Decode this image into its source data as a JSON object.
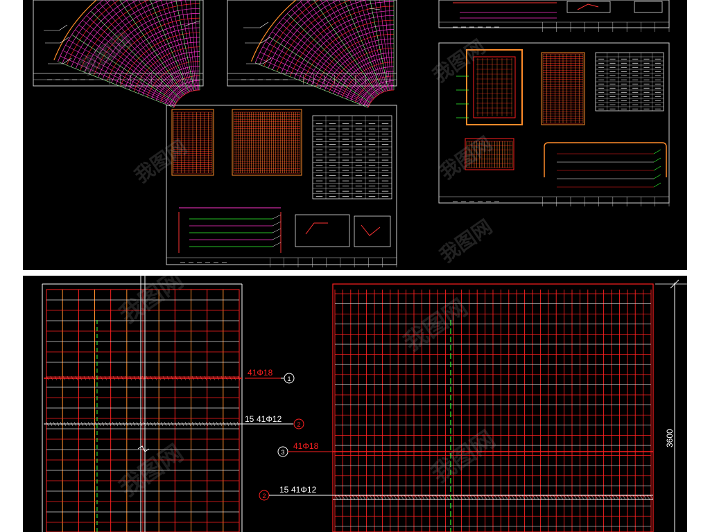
{
  "watermark": {
    "text": "我图网"
  },
  "detail": {
    "callout_top_bar": {
      "label": "41Φ18",
      "number": "1"
    },
    "callout_left_grid": {
      "count": "15",
      "label": "41Φ12",
      "number": "2"
    },
    "callout_right_bar": {
      "label": "41Φ18",
      "number": "3"
    },
    "callout_right_grid": {
      "count": "15",
      "label": "41Φ12",
      "number": "2"
    },
    "dimension": "3600"
  },
  "colors": {
    "background": "#000000",
    "frame": "#ffffff",
    "rebar_red": "#ff2020",
    "rebar_orange": "#ff8c2a",
    "rebar_magenta": "#ff33cc",
    "centerline_green": "#33ff33",
    "table_white": "#e8e8e8"
  },
  "icons": [
    "watermark-logo-icon",
    "circle-callout-icon"
  ]
}
